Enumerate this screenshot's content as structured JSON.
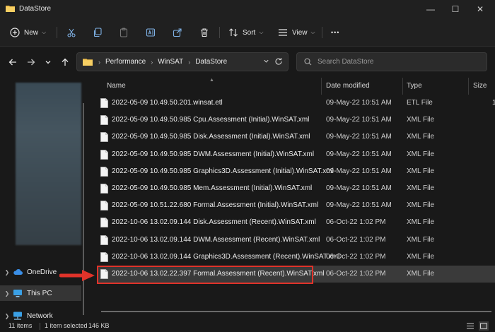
{
  "window": {
    "title": "DataStore",
    "minimize": "—",
    "maximize": "☐",
    "close": "✕"
  },
  "toolbar": {
    "new_label": "New",
    "sort_label": "Sort",
    "view_label": "View",
    "more_label": "•••"
  },
  "address": {
    "crumbs": [
      "Performance",
      "WinSAT",
      "DataStore"
    ],
    "search_placeholder": "Search DataStore"
  },
  "nav": {
    "onedrive": "OneDrive",
    "this_pc": "This PC",
    "network": "Network"
  },
  "columns": {
    "name": "Name",
    "date": "Date modified",
    "type": "Type",
    "size": "Size"
  },
  "files": [
    {
      "name": "2022-05-09 10.49.50.201.winsat.etl",
      "date": "09-May-22 10:51 AM",
      "type": "ETL File",
      "size": "1"
    },
    {
      "name": "2022-05-09 10.49.50.985 Cpu.Assessment (Initial).WinSAT.xml",
      "date": "09-May-22 10:51 AM",
      "type": "XML File",
      "size": ""
    },
    {
      "name": "2022-05-09 10.49.50.985 Disk.Assessment (Initial).WinSAT.xml",
      "date": "09-May-22 10:51 AM",
      "type": "XML File",
      "size": ""
    },
    {
      "name": "2022-05-09 10.49.50.985 DWM.Assessment (Initial).WinSAT.xml",
      "date": "09-May-22 10:51 AM",
      "type": "XML File",
      "size": ""
    },
    {
      "name": "2022-05-09 10.49.50.985 Graphics3D.Assessment (Initial).WinSAT.xml",
      "date": "09-May-22 10:51 AM",
      "type": "XML File",
      "size": ""
    },
    {
      "name": "2022-05-09 10.49.50.985 Mem.Assessment (Initial).WinSAT.xml",
      "date": "09-May-22 10:51 AM",
      "type": "XML File",
      "size": ""
    },
    {
      "name": "2022-05-09 10.51.22.680 Formal.Assessment (Initial).WinSAT.xml",
      "date": "09-May-22 10:51 AM",
      "type": "XML File",
      "size": ""
    },
    {
      "name": "2022-10-06 13.02.09.144 Disk.Assessment (Recent).WinSAT.xml",
      "date": "06-Oct-22 1:02 PM",
      "type": "XML File",
      "size": ""
    },
    {
      "name": "2022-10-06 13.02.09.144 DWM.Assessment (Recent).WinSAT.xml",
      "date": "06-Oct-22 1:02 PM",
      "type": "XML File",
      "size": ""
    },
    {
      "name": "2022-10-06 13.02.09.144 Graphics3D.Assessment (Recent).WinSAT.xml",
      "date": "06-Oct-22 1:02 PM",
      "type": "XML File",
      "size": ""
    },
    {
      "name": "2022-10-06 13.02.22.397 Formal.Assessment (Recent).WinSAT.xml",
      "date": "06-Oct-22 1:02 PM",
      "type": "XML File",
      "size": ""
    }
  ],
  "status": {
    "items": "11 items",
    "selected": "1 item selected",
    "size": "146 KB"
  },
  "colors": {
    "accent_red": "#e0332a",
    "folder_yellow": "#f2c14e",
    "background": "#191919"
  }
}
